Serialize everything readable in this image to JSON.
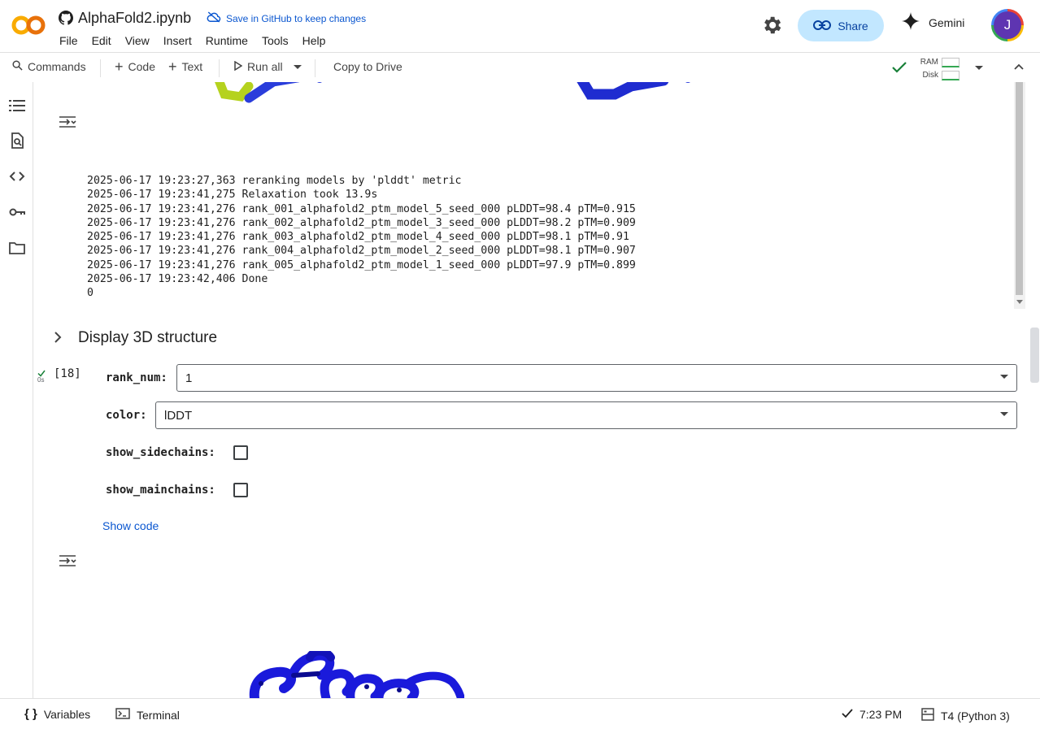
{
  "header": {
    "logo_text": "CO",
    "notebook_title": "AlphaFold2.ipynb",
    "save_github_label": "Save in GitHub to keep changes",
    "share_label": "Share",
    "gemini_label": "Gemini",
    "avatar_initial": "J",
    "menu": [
      "File",
      "Edit",
      "View",
      "Insert",
      "Runtime",
      "Tools",
      "Help"
    ]
  },
  "toolbar": {
    "commands_label": "Commands",
    "code_label": "Code",
    "text_label": "Text",
    "run_all_label": "Run all",
    "copy_to_drive_label": "Copy to Drive",
    "ram_label": "RAM",
    "disk_label": "Disk"
  },
  "output": {
    "log_lines": [
      "2025-06-17 19:23:27,363 reranking models by 'plddt' metric",
      "2025-06-17 19:23:41,275 Relaxation took 13.9s",
      "2025-06-17 19:23:41,276 rank_001_alphafold2_ptm_model_5_seed_000 pLDDT=98.4 pTM=0.915",
      "2025-06-17 19:23:41,276 rank_002_alphafold2_ptm_model_3_seed_000 pLDDT=98.2 pTM=0.909",
      "2025-06-17 19:23:41,276 rank_003_alphafold2_ptm_model_4_seed_000 pLDDT=98.1 pTM=0.91",
      "2025-06-17 19:23:41,276 rank_004_alphafold2_ptm_model_2_seed_000 pLDDT=98.1 pTM=0.907",
      "2025-06-17 19:23:41,276 rank_005_alphafold2_ptm_model_1_seed_000 pLDDT=97.9 pTM=0.899",
      "2025-06-17 19:23:42,406 Done",
      "0"
    ]
  },
  "section": {
    "title": "Display 3D structure"
  },
  "cell": {
    "exec_count": "[18]",
    "exec_time": "0s",
    "rank_num_label": "rank_num:",
    "rank_num_value": "1",
    "color_label": "color:",
    "color_value": "lDDT",
    "show_sidechains_label": "show_sidechains:",
    "show_sidechains_checked": false,
    "show_mainchains_label": "show_mainchains:",
    "show_mainchains_checked": false,
    "show_code_label": "Show code"
  },
  "statusbar": {
    "variables_label": "Variables",
    "terminal_label": "Terminal",
    "time_label": "7:23 PM",
    "runtime_label": "T4 (Python 3)"
  },
  "colors": {
    "accent": "#0b57d0",
    "share_bg": "#c2e7ff",
    "protein_blue": "#1a1adb",
    "protein_yellow": "#b5d21e",
    "success_green": "#188038"
  }
}
